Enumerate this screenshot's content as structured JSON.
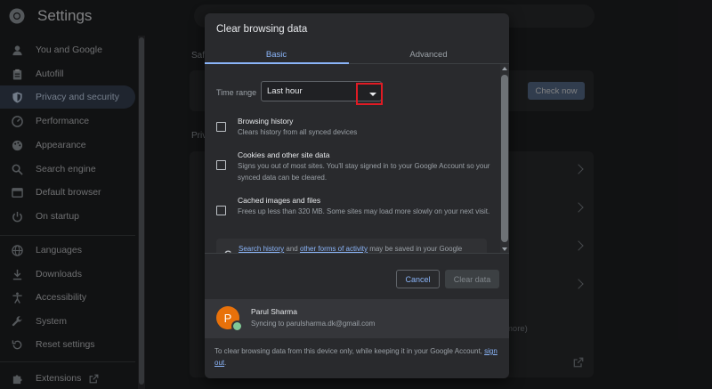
{
  "app": {
    "title": "Settings"
  },
  "sidebar": {
    "items": [
      {
        "label": "You and Google",
        "icon": "person-icon"
      },
      {
        "label": "Autofill",
        "icon": "clipboard-icon"
      },
      {
        "label": "Privacy and security",
        "icon": "shield-icon",
        "active": true
      },
      {
        "label": "Performance",
        "icon": "speedometer-icon"
      },
      {
        "label": "Appearance",
        "icon": "palette-icon"
      },
      {
        "label": "Search engine",
        "icon": "search-icon"
      },
      {
        "label": "Default browser",
        "icon": "browser-icon"
      },
      {
        "label": "On startup",
        "icon": "power-icon"
      },
      {
        "label": "Languages",
        "icon": "globe-icon"
      },
      {
        "label": "Downloads",
        "icon": "download-icon"
      },
      {
        "label": "Accessibility",
        "icon": "accessibility-icon"
      },
      {
        "label": "System",
        "icon": "wrench-icon"
      },
      {
        "label": "Reset settings",
        "icon": "reset-icon"
      }
    ],
    "extensions": {
      "label": "Extensions",
      "icon": "puzzle-icon"
    }
  },
  "main": {
    "safety_heading": "Saf",
    "privacy_heading": "Priv",
    "check_now_label": "Check now",
    "more_text": "more)"
  },
  "dialog": {
    "title": "Clear browsing data",
    "tabs": {
      "basic": "Basic",
      "advanced": "Advanced"
    },
    "time_range": {
      "label": "Time range",
      "value": "Last hour"
    },
    "options": [
      {
        "title": "Browsing history",
        "desc": "Clears history from all synced devices",
        "checked": false
      },
      {
        "title": "Cookies and other site data",
        "desc": "Signs you out of most sites. You'll stay signed in to your Google Account so your synced data can be cleared.",
        "checked": false
      },
      {
        "title": "Cached images and files",
        "desc": "Frees up less than 320 MB. Some sites may load more slowly on your next visit.",
        "checked": false
      }
    ],
    "google_note": {
      "link1": "Search history",
      "mid1": " and ",
      "link2": "other forms of activity",
      "rest": " may be saved in your Google Account when you're signed in. You can delete them anytime."
    },
    "buttons": {
      "cancel": "Cancel",
      "clear": "Clear data"
    },
    "profile": {
      "initial": "P",
      "name": "Parul Sharma",
      "sync": "Syncing to parulsharma.dk@gmail.com"
    },
    "footer": {
      "text": "To clear browsing data from this device only, while keeping it in your Google Account, ",
      "link": "sign out",
      "end": "."
    }
  },
  "colors": {
    "accent": "#8ab4f8",
    "highlight_box": "#e01b24",
    "avatar": "#e8710a",
    "active_nav": "#394457"
  }
}
